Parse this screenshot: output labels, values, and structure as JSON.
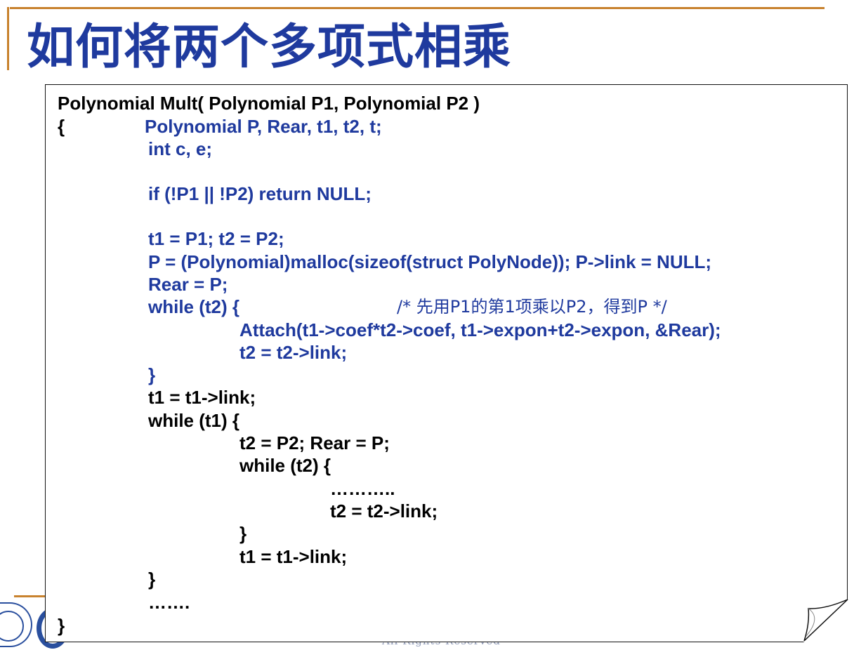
{
  "slide": {
    "title": "如何将两个多项式相乘",
    "footer_text": "All Rights Reserved"
  },
  "code": {
    "signature": "Polynomial Mult( Polynomial P1, Polynomial P2 )",
    "open_brace": "{",
    "decl_vars": "Polynomial P, Rear, t1, t2, t;",
    "decl_int": "int c, e;",
    "null_check": "if (!P1 || !P2) return NULL;",
    "init_t": "t1 = P1; t2 = P2;",
    "malloc": "P = (Polynomial)malloc(sizeof(struct PolyNode)); P->link = NULL;",
    "rear_init": "Rear = P;",
    "while_t2_1": "while (t2) {",
    "comment_1": "/* 先用P1的第1项乘以P2，得到P */",
    "attach": "Attach(t1->coef*t2->coef, t1->expon+t2->expon, &Rear);",
    "advance_t2_1": "t2 = t2->link;",
    "close_1": "}",
    "advance_t1_1": "t1 = t1->link;",
    "while_t1": "while (t1) {",
    "reset": "t2 = P2; Rear = P;",
    "while_t2_2": "while (t2) {",
    "ellipsis_1": "………..",
    "advance_t2_2": "t2 = t2->link;",
    "close_2": "}",
    "advance_t1_2": "t1 = t1->link;",
    "close_3": "}",
    "ellipsis_2": "…….",
    "close_func": "}"
  },
  "colors": {
    "title": "#1f3a9e",
    "code_blue": "#1f3a9e",
    "code_black": "#000000",
    "accent_line": "#c8822e"
  }
}
